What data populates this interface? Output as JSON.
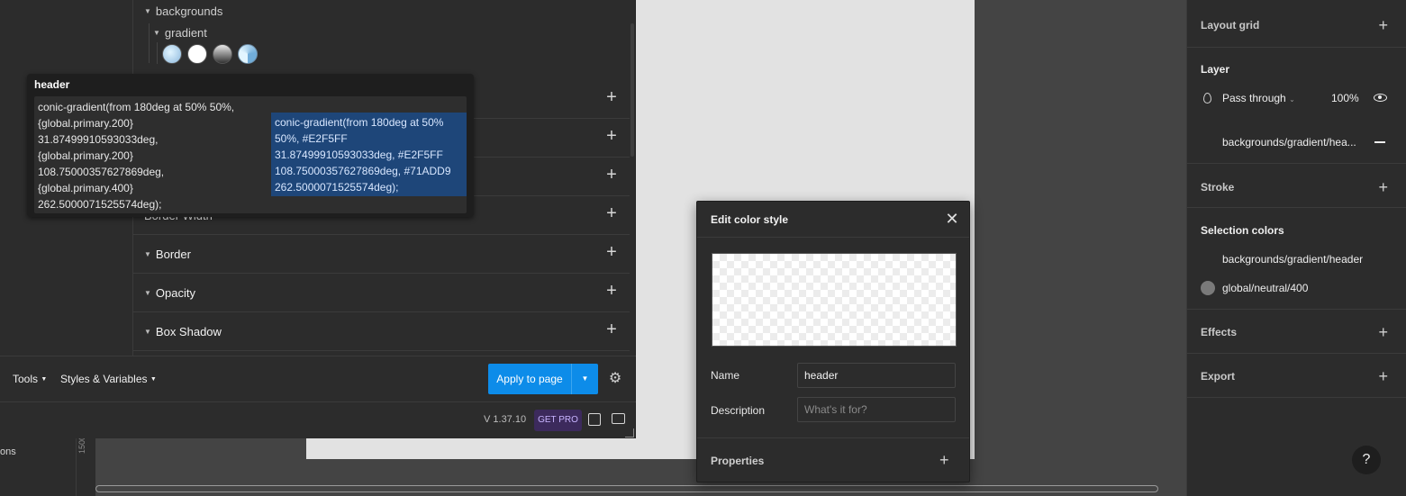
{
  "plugin": {
    "tree": {
      "backgrounds": "backgrounds",
      "gradient": "gradient"
    },
    "property_rows": [
      {
        "label": ""
      },
      {
        "label": ""
      },
      {
        "label": ""
      },
      {
        "label": "Border Width"
      },
      {
        "label": "Border"
      },
      {
        "label": "Opacity"
      },
      {
        "label": "Box Shadow"
      }
    ],
    "toolbar": {
      "tools": "Tools",
      "styles_variables": "Styles & Variables",
      "apply": "Apply to page",
      "version": "V 1.37.10",
      "get_pro": "GET PRO"
    },
    "tooltip": {
      "title": "header",
      "raw_value": "conic-gradient(from 180deg at 50% 50%,\n{global.primary.200}\n31.87499910593033deg,\n{global.primary.200}\n108.75000357627869deg,\n{global.primary.400}\n262.5000071525574deg);",
      "resolved_value": "conic-gradient(from 180deg at 50%\n50%, #E2F5FF\n31.87499910593033deg, #E2F5FF\n108.75000357627869deg, #71ADD9\n262.5000071525574deg);"
    }
  },
  "canvas": {
    "left_label": "ons",
    "ruler_value": "1500"
  },
  "dialog": {
    "title": "Edit color style",
    "name_label": "Name",
    "name_value": "header",
    "description_label": "Description",
    "description_placeholder": "What's it for?",
    "properties_label": "Properties"
  },
  "right_panel": {
    "layout_grid": "Layout grid",
    "layer": "Layer",
    "blend_mode": "Pass through",
    "opacity": "100%",
    "fill_style": "backgrounds/gradient/hea...",
    "stroke": "Stroke",
    "selection_colors": "Selection colors",
    "selection_color_1": "backgrounds/gradient/header",
    "selection_color_2": "global/neutral/400",
    "effects": "Effects",
    "export": "Export",
    "help": "?"
  },
  "colors": {
    "accent": "#0d8ce9",
    "primary_200": "#E2F5FF",
    "primary_400": "#71ADD9",
    "panel_bg": "#2c2c2c",
    "highlight": "#1e4679"
  }
}
